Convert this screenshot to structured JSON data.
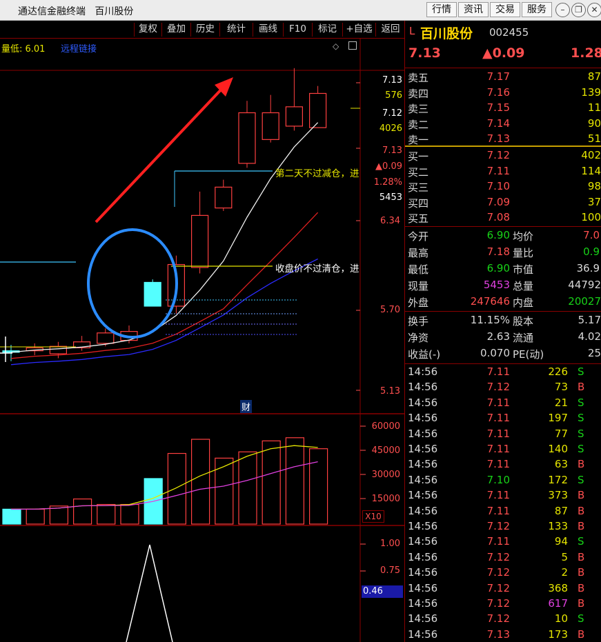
{
  "app": {
    "title": "通达信金融终端   百川股份",
    "nav": [
      "行情",
      "资讯",
      "交易",
      "服务"
    ],
    "window_icons": [
      "minimize-icon",
      "restore-icon",
      "close-icon"
    ]
  },
  "toolbar": [
    "复权",
    "叠加",
    "历史",
    "统计",
    "画线",
    "F10",
    "标记",
    "+自选",
    "返回"
  ],
  "chart": {
    "info_low": "量低: 6.01",
    "info_blue": "远程链接",
    "price_axis": [
      "6.34",
      "5.70",
      "5.13"
    ],
    "cursor_block": [
      "7.13",
      "576",
      "7.12",
      "4026",
      "7.13",
      "▲0.09",
      "1.28%",
      "5453"
    ],
    "annotations": [
      "第二天不过减仓，进",
      "收盘价不过清仓，进"
    ],
    "fin_marker": "财",
    "volume_axis": [
      "60000",
      "45000",
      "30000",
      "15000"
    ],
    "volume_unit": "X10",
    "indicator_axis": [
      "1.00",
      "0.75",
      "0.46"
    ]
  },
  "chart_data": {
    "type": "candlestick",
    "candles": [
      {
        "o": 5.4,
        "c": 5.39,
        "h": 5.44,
        "l": 5.33
      },
      {
        "o": 5.4,
        "c": 5.42,
        "h": 5.45,
        "l": 5.37
      },
      {
        "o": 5.38,
        "c": 5.43,
        "h": 5.46,
        "l": 5.35
      },
      {
        "o": 5.42,
        "c": 5.46,
        "h": 5.5,
        "l": 5.4
      },
      {
        "o": 5.45,
        "c": 5.52,
        "h": 5.55,
        "l": 5.43
      },
      {
        "o": 5.47,
        "c": 5.53,
        "h": 5.57,
        "l": 5.45
      },
      {
        "o": 5.86,
        "c": 5.7,
        "h": 5.88,
        "l": 5.7
      },
      {
        "o": 5.7,
        "c": 5.98,
        "h": 6.04,
        "l": 5.65
      },
      {
        "o": 5.96,
        "c": 6.31,
        "h": 6.47,
        "l": 5.92
      },
      {
        "o": 6.36,
        "c": 6.5,
        "h": 6.55,
        "l": 6.34
      },
      {
        "o": 6.66,
        "c": 7.0,
        "h": 7.08,
        "l": 6.63
      },
      {
        "o": 6.82,
        "c": 7.0,
        "h": 7.12,
        "l": 6.8
      },
      {
        "o": 6.91,
        "c": 7.04,
        "h": 7.3,
        "l": 6.88
      },
      {
        "o": 6.9,
        "c": 7.13,
        "h": 7.18,
        "l": 6.9
      }
    ],
    "volume": [
      9500,
      9500,
      11500,
      16000,
      12500,
      12500,
      29000,
      45000,
      54000,
      42000,
      46000,
      53000,
      55000,
      48000
    ],
    "price_range": [
      5.0,
      7.35
    ]
  },
  "stock": {
    "prefix": "L",
    "name": "百川股份",
    "code": "002455",
    "price": "7.13",
    "change": "▲0.09",
    "pct": "1.28"
  },
  "order_book": {
    "asks": [
      {
        "label": "卖五",
        "price": "7.17",
        "vol": "87"
      },
      {
        "label": "卖四",
        "price": "7.16",
        "vol": "139"
      },
      {
        "label": "卖三",
        "price": "7.15",
        "vol": "11"
      },
      {
        "label": "卖二",
        "price": "7.14",
        "vol": "90"
      },
      {
        "label": "卖一",
        "price": "7.13",
        "vol": "51"
      }
    ],
    "bids": [
      {
        "label": "买一",
        "price": "7.12",
        "vol": "402"
      },
      {
        "label": "买二",
        "price": "7.11",
        "vol": "114"
      },
      {
        "label": "买三",
        "price": "7.10",
        "vol": "98"
      },
      {
        "label": "买四",
        "price": "7.09",
        "vol": "37"
      },
      {
        "label": "买五",
        "price": "7.08",
        "vol": "100"
      }
    ]
  },
  "quote": {
    "open_l": "今开",
    "open_v": "6.90",
    "avg_l": "均价",
    "avg_v": "7.0",
    "high_l": "最高",
    "high_v": "7.18",
    "ratio_l": "量比",
    "ratio_v": "0.9",
    "low_l": "最低",
    "low_v": "6.90",
    "mcap_l": "市值",
    "mcap_v": "36.9",
    "cur_l": "现量",
    "cur_v": "5453",
    "tvol_l": "总量",
    "tvol_v": "44792",
    "out_l": "外盘",
    "out_v": "247646",
    "in_l": "内盘",
    "in_v": "20027",
    "turn_l": "换手",
    "turn_v": "11.15%",
    "cap_l": "股本",
    "cap_v": "5.17",
    "nav_l": "净资",
    "nav_v": "2.63",
    "float_l": "流通",
    "float_v": "4.02",
    "eps_l": "收益(-)",
    "eps_v": "0.070",
    "pe_l": "PE(动)",
    "pe_v": "25"
  },
  "ticks": [
    {
      "t": "14:56",
      "p": "7.11",
      "v": "226",
      "s": "S"
    },
    {
      "t": "14:56",
      "p": "7.12",
      "v": "73",
      "s": "B"
    },
    {
      "t": "14:56",
      "p": "7.11",
      "v": "21",
      "s": "S"
    },
    {
      "t": "14:56",
      "p": "7.11",
      "v": "197",
      "s": "S"
    },
    {
      "t": "14:56",
      "p": "7.11",
      "v": "77",
      "s": "S"
    },
    {
      "t": "14:56",
      "p": "7.11",
      "v": "140",
      "s": "S"
    },
    {
      "t": "14:56",
      "p": "7.11",
      "v": "63",
      "s": "B"
    },
    {
      "t": "14:56",
      "p": "7.10",
      "v": "172",
      "s": "S"
    },
    {
      "t": "14:56",
      "p": "7.11",
      "v": "373",
      "s": "B"
    },
    {
      "t": "14:56",
      "p": "7.11",
      "v": "87",
      "s": "B"
    },
    {
      "t": "14:56",
      "p": "7.12",
      "v": "133",
      "s": "B"
    },
    {
      "t": "14:56",
      "p": "7.11",
      "v": "94",
      "s": "S"
    },
    {
      "t": "14:56",
      "p": "7.12",
      "v": "5",
      "s": "B"
    },
    {
      "t": "14:56",
      "p": "7.12",
      "v": "2",
      "s": "B"
    },
    {
      "t": "14:56",
      "p": "7.12",
      "v": "368",
      "s": "B"
    },
    {
      "t": "14:56",
      "p": "7.12",
      "v": "617",
      "s": "B"
    },
    {
      "t": "14:56",
      "p": "7.12",
      "v": "10",
      "s": "S"
    },
    {
      "t": "14:56",
      "p": "7.13",
      "v": "173",
      "s": "B"
    }
  ]
}
